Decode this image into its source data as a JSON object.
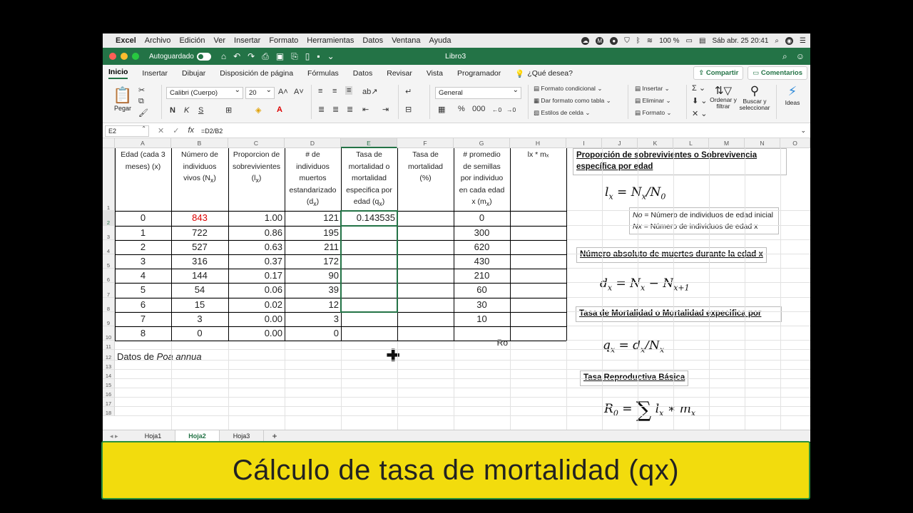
{
  "macmenu": {
    "app": "Excel",
    "items": [
      "Archivo",
      "Edición",
      "Ver",
      "Insertar",
      "Formato",
      "Herramientas",
      "Datos",
      "Ventana",
      "Ayuda"
    ],
    "battery": "100 %",
    "datetime": "Sáb abr. 25  20:41"
  },
  "titlebar": {
    "autosave": "Autoguardado",
    "doc": "Libro3"
  },
  "ribbon_tabs": [
    "Inicio",
    "Insertar",
    "Dibujar",
    "Disposición de página",
    "Fórmulas",
    "Datos",
    "Revisar",
    "Vista",
    "Programador"
  ],
  "tell_me": "¿Qué desea?",
  "share": "Compartir",
  "comments": "Comentarios",
  "ribbon": {
    "paste": "Pegar",
    "font": "Calibri (Cuerpo)",
    "size": "20",
    "bold": "N",
    "italic": "K",
    "underline": "S",
    "number_format": "General",
    "cond_format": "Formato condicional",
    "table_format": "Dar formato como tabla",
    "cell_styles": "Estilos de celda",
    "insert": "Insertar",
    "delete": "Eliminar",
    "format": "Formato",
    "sort": "Ordenar y filtrar",
    "find": "Buscar y seleccionar",
    "ideas": "Ideas",
    "percent": "%",
    "thousands": "000"
  },
  "formula_bar": {
    "cell": "E2",
    "formula": "=D2/B2"
  },
  "columns": [
    "A",
    "B",
    "C",
    "D",
    "E",
    "F",
    "G",
    "H",
    "I",
    "J",
    "K",
    "L",
    "M",
    "N",
    "O"
  ],
  "rows": [
    "1",
    "2",
    "3",
    "4",
    "5",
    "6",
    "7",
    "8",
    "9",
    "10",
    "11",
    "12",
    "13",
    "14",
    "15",
    "16",
    "17",
    "18"
  ],
  "headers": {
    "a": [
      "Edad (cada 3",
      "meses) (x)"
    ],
    "b": [
      "Número de",
      "individuos",
      "vivos (N"
    ],
    "c": [
      "Proporcion de",
      "sobrevivientes",
      "(l"
    ],
    "d": [
      "# de",
      "individuos",
      "muertos",
      "estandarizado",
      "(d"
    ],
    "e": [
      "Tasa de",
      "mortalidad o",
      "mortalidad",
      "especifica por",
      "edad (q"
    ],
    "f": [
      "Tasa de",
      "mortalidad",
      "(%)"
    ],
    "g": [
      "# promedio",
      "de semillas",
      "por individuo",
      "en cada edad",
      "x (m"
    ],
    "h": "lx * mₓ",
    "sub_x": "x",
    "close": ")"
  },
  "table": {
    "age": [
      "0",
      "1",
      "2",
      "3",
      "4",
      "5",
      "6",
      "7",
      "8"
    ],
    "n": [
      "843",
      "722",
      "527",
      "316",
      "144",
      "54",
      "15",
      "3",
      "0"
    ],
    "l": [
      "1.00",
      "0.86",
      "0.63",
      "0.37",
      "0.17",
      "0.06",
      "0.02",
      "0.00",
      "0.00"
    ],
    "d": [
      "121",
      "195",
      "211",
      "172",
      "90",
      "39",
      "12",
      "3",
      "0"
    ],
    "q": [
      "0.143535",
      "",
      "",
      "",
      "",
      "",
      "",
      "",
      ""
    ],
    "m": [
      "0",
      "300",
      "620",
      "430",
      "210",
      "60",
      "30",
      "10",
      ""
    ]
  },
  "ro_label": "Ro",
  "caption": {
    "text": "Datos de ",
    "italic": "Poa annua"
  },
  "notes": {
    "survival": [
      "Proporción de sobrevivientes o Sobrevivencia",
      "específica por edad"
    ],
    "legend": [
      {
        "sym": "No",
        "text": " = Número de individuos de edad inicial"
      },
      {
        "sym": "Nx",
        "text": " = Número de individuos de edad x"
      }
    ],
    "deaths": "Número absoluto de muertes durante la edad x",
    "mortality": "Tasa de Mortalidad o Mortalidad expecifica por",
    "repro": "Tasa Reproductiva Básica"
  },
  "sheets": [
    "Hoja1",
    "Hoja2",
    "Hoja3"
  ],
  "active_sheet": "Hoja2",
  "banner": "Cálculo de tasa de mortalidad (qx)",
  "colors": {
    "excel_green": "#237346",
    "banner": "#f2dc0d",
    "banner_border": "#2a8f3d",
    "highlight": "#d00000"
  }
}
